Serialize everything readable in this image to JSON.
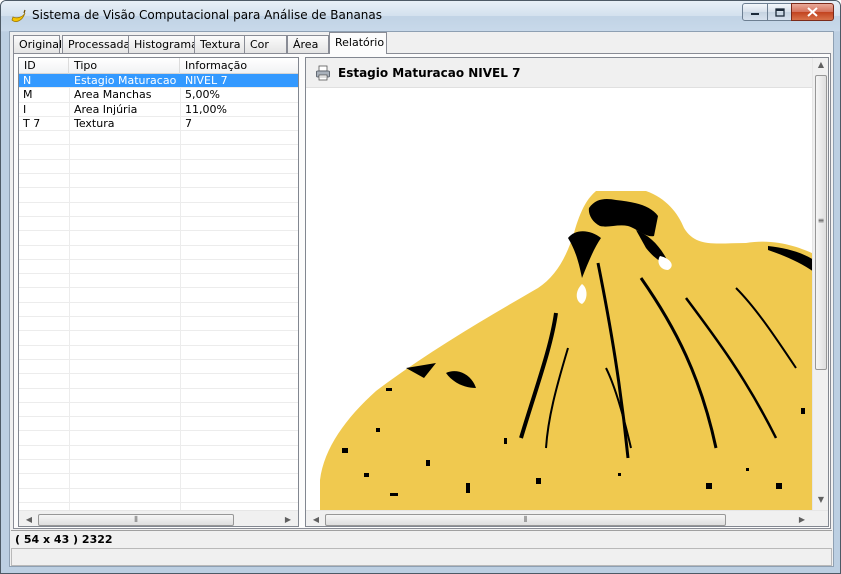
{
  "window": {
    "title": "Sistema de Visão Computacional para Análise de Bananas",
    "icon": "banana-icon"
  },
  "tabs": [
    {
      "label": "Original",
      "active": false
    },
    {
      "label": "Processada",
      "active": false
    },
    {
      "label": "Histograma",
      "active": false
    },
    {
      "label": "Textura",
      "active": false
    },
    {
      "label": "Cor",
      "active": false
    },
    {
      "label": "Área",
      "active": false
    },
    {
      "label": "Relatório",
      "active": true
    }
  ],
  "table": {
    "columns": [
      "ID",
      "Tipo",
      "Informação"
    ],
    "rows": [
      {
        "id": "N",
        "tipo": "Estagio Maturacao",
        "info": "NIVEL 7",
        "selected": true
      },
      {
        "id": "M",
        "tipo": "Area Manchas",
        "info": "5,00%",
        "selected": false
      },
      {
        "id": "I",
        "tipo": "Area Injúria",
        "info": "11,00%",
        "selected": false
      },
      {
        "id": "T 7",
        "tipo": "Textura",
        "info": "7",
        "selected": false
      }
    ]
  },
  "report": {
    "title": "Estagio Maturacao  NIVEL 7",
    "icon": "printer-icon",
    "banana_color": "#f0c94f"
  },
  "status": {
    "line1": "( 54 x 43 ) 2322",
    "line2": ""
  },
  "colors": {
    "selection": "#3399ff",
    "close_button": "#c2431f"
  }
}
